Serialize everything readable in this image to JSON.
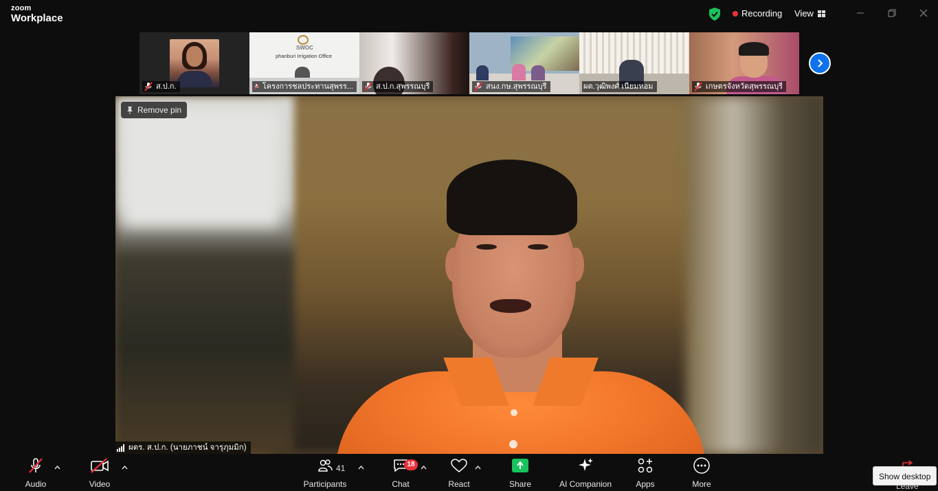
{
  "app": {
    "brand_top": "zoom",
    "brand_bottom": "Workplace",
    "recording_label": "Recording",
    "view_label": "View"
  },
  "colors": {
    "accent_blue": "#0e72ed",
    "record_red": "#e8323b",
    "share_green": "#19c35d",
    "muted_red": "#e8323b"
  },
  "thumbnails": [
    {
      "name": "ส.ป.ก.",
      "muted": true
    },
    {
      "name": "โครงการชลประทานสุพรร...",
      "muted": true,
      "sign": "SWOC",
      "office": "phanburi Irrigation Office"
    },
    {
      "name": "ส.ป.ก.สุพรรณบุรี",
      "muted": true
    },
    {
      "name": "สนง.กษ.สุพรรณบุรี",
      "muted": true
    },
    {
      "name": "ผต.วุฒิพงศ์ เนียมหอม",
      "muted": false
    },
    {
      "name": "เกษตรจังหวัดสุพรรณบุรี",
      "muted": true
    }
  ],
  "main_video": {
    "remove_pin_label": "Remove pin",
    "speaker_name": "ผตร. ส.ป.ก. (นายภาชน์ จารุภุมมิก)"
  },
  "toolbar": {
    "audio_label": "Audio",
    "video_label": "Video",
    "participants_label": "Participants",
    "participants_count": "41",
    "chat_label": "Chat",
    "chat_badge": "18",
    "react_label": "React",
    "share_label": "Share",
    "ai_label": "AI Companion",
    "apps_label": "Apps",
    "more_label": "More",
    "leave_label": "Leave"
  },
  "tooltip": {
    "text": "Show desktop"
  }
}
